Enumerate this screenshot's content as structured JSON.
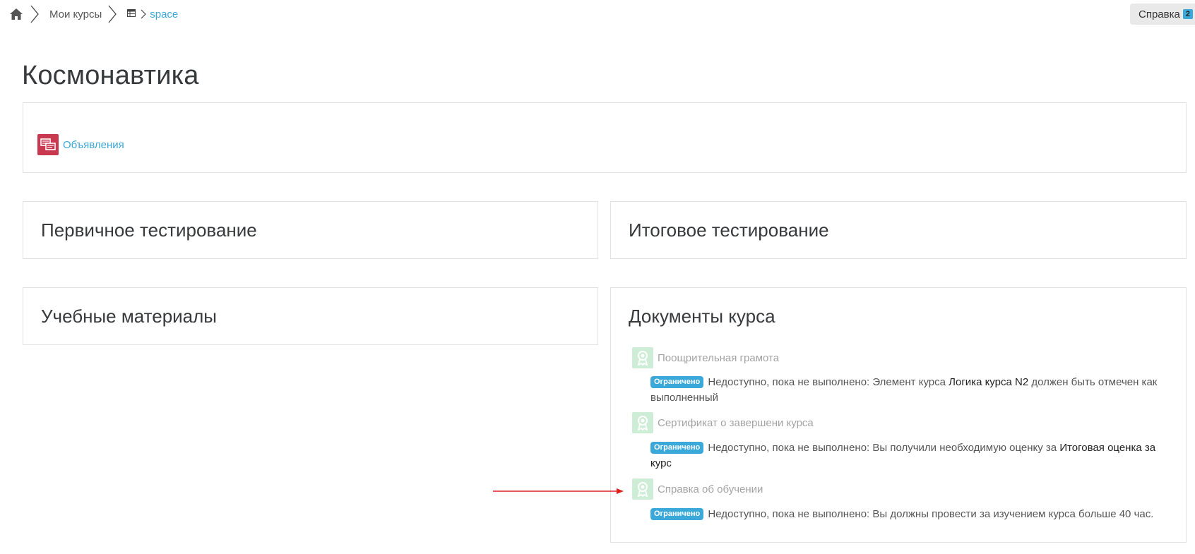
{
  "breadcrumb": {
    "my_courses": "Мои курсы",
    "course": "space"
  },
  "help": {
    "label": "Справка",
    "badge": "2"
  },
  "page": {
    "title": "Космонавтика"
  },
  "general_section": {
    "activity_label": "Объявления"
  },
  "sections": [
    {
      "title": "Первичное тестирование"
    },
    {
      "title": "Итоговое тестирование"
    },
    {
      "title": "Учебные материалы"
    },
    {
      "title": "Документы курса"
    }
  ],
  "documents": {
    "restricted_badge": "Ограничено",
    "items": [
      {
        "name": "Поощрительная грамота",
        "text_before": "Недоступно, пока не выполнено: Элемент курса ",
        "bold": "Логика курса N2",
        "text_after": " должен быть отмечен как выполненный"
      },
      {
        "name": "Сертификат о завершени курса",
        "text_before": "Недоступно, пока не выполнено: Вы получили необходимую оценку за ",
        "bold": "Итоговая оценка за курс",
        "text_after": ""
      },
      {
        "name": "Справка об обучении",
        "text_before": "Недоступно, пока не выполнено: Вы должны провести за изучением курса больше 40 час.",
        "bold": "",
        "text_after": ""
      }
    ]
  },
  "colors": {
    "link": "#3aa8d8",
    "forum_icon": "#c8384f",
    "cert_icon": "#c9ecd3",
    "annotation_arrow": "#e02020"
  }
}
